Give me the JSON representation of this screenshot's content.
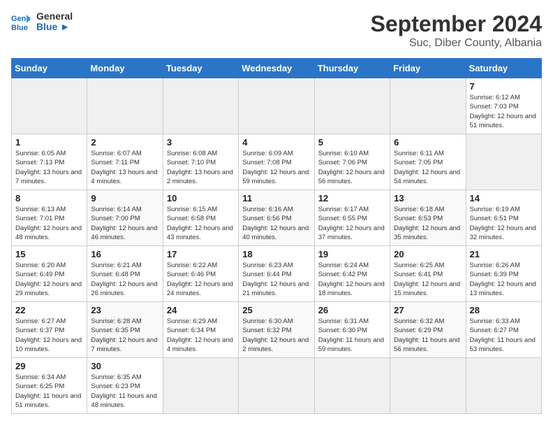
{
  "header": {
    "logo_line1": "General",
    "logo_line2": "Blue",
    "month": "September 2024",
    "location": "Suc, Diber County, Albania"
  },
  "weekdays": [
    "Sunday",
    "Monday",
    "Tuesday",
    "Wednesday",
    "Thursday",
    "Friday",
    "Saturday"
  ],
  "days": [
    {
      "num": "",
      "sunrise": "",
      "sunset": "",
      "daylight": ""
    },
    {
      "num": "",
      "sunrise": "",
      "sunset": "",
      "daylight": ""
    },
    {
      "num": "",
      "sunrise": "",
      "sunset": "",
      "daylight": ""
    },
    {
      "num": "",
      "sunrise": "",
      "sunset": "",
      "daylight": ""
    },
    {
      "num": "",
      "sunrise": "",
      "sunset": "",
      "daylight": ""
    },
    {
      "num": "",
      "sunrise": "",
      "sunset": "",
      "daylight": ""
    },
    {
      "num": "7",
      "sunrise": "Sunrise: 6:12 AM",
      "sunset": "Sunset: 7:03 PM",
      "daylight": "Daylight: 12 hours and 51 minutes."
    },
    {
      "num": "1",
      "sunrise": "Sunrise: 6:05 AM",
      "sunset": "Sunset: 7:13 PM",
      "daylight": "Daylight: 13 hours and 7 minutes."
    },
    {
      "num": "2",
      "sunrise": "Sunrise: 6:07 AM",
      "sunset": "Sunset: 7:11 PM",
      "daylight": "Daylight: 13 hours and 4 minutes."
    },
    {
      "num": "3",
      "sunrise": "Sunrise: 6:08 AM",
      "sunset": "Sunset: 7:10 PM",
      "daylight": "Daylight: 13 hours and 2 minutes."
    },
    {
      "num": "4",
      "sunrise": "Sunrise: 6:09 AM",
      "sunset": "Sunset: 7:08 PM",
      "daylight": "Daylight: 12 hours and 59 minutes."
    },
    {
      "num": "5",
      "sunrise": "Sunrise: 6:10 AM",
      "sunset": "Sunset: 7:06 PM",
      "daylight": "Daylight: 12 hours and 56 minutes."
    },
    {
      "num": "6",
      "sunrise": "Sunrise: 6:11 AM",
      "sunset": "Sunset: 7:05 PM",
      "daylight": "Daylight: 12 hours and 54 minutes."
    },
    {
      "num": "",
      "sunrise": "",
      "sunset": "",
      "daylight": ""
    },
    {
      "num": "8",
      "sunrise": "Sunrise: 6:13 AM",
      "sunset": "Sunset: 7:01 PM",
      "daylight": "Daylight: 12 hours and 48 minutes."
    },
    {
      "num": "9",
      "sunrise": "Sunrise: 6:14 AM",
      "sunset": "Sunset: 7:00 PM",
      "daylight": "Daylight: 12 hours and 46 minutes."
    },
    {
      "num": "10",
      "sunrise": "Sunrise: 6:15 AM",
      "sunset": "Sunset: 6:58 PM",
      "daylight": "Daylight: 12 hours and 43 minutes."
    },
    {
      "num": "11",
      "sunrise": "Sunrise: 6:16 AM",
      "sunset": "Sunset: 6:56 PM",
      "daylight": "Daylight: 12 hours and 40 minutes."
    },
    {
      "num": "12",
      "sunrise": "Sunrise: 6:17 AM",
      "sunset": "Sunset: 6:55 PM",
      "daylight": "Daylight: 12 hours and 37 minutes."
    },
    {
      "num": "13",
      "sunrise": "Sunrise: 6:18 AM",
      "sunset": "Sunset: 6:53 PM",
      "daylight": "Daylight: 12 hours and 35 minutes."
    },
    {
      "num": "14",
      "sunrise": "Sunrise: 6:19 AM",
      "sunset": "Sunset: 6:51 PM",
      "daylight": "Daylight: 12 hours and 32 minutes."
    },
    {
      "num": "15",
      "sunrise": "Sunrise: 6:20 AM",
      "sunset": "Sunset: 6:49 PM",
      "daylight": "Daylight: 12 hours and 29 minutes."
    },
    {
      "num": "16",
      "sunrise": "Sunrise: 6:21 AM",
      "sunset": "Sunset: 6:48 PM",
      "daylight": "Daylight: 12 hours and 26 minutes."
    },
    {
      "num": "17",
      "sunrise": "Sunrise: 6:22 AM",
      "sunset": "Sunset: 6:46 PM",
      "daylight": "Daylight: 12 hours and 24 minutes."
    },
    {
      "num": "18",
      "sunrise": "Sunrise: 6:23 AM",
      "sunset": "Sunset: 6:44 PM",
      "daylight": "Daylight: 12 hours and 21 minutes."
    },
    {
      "num": "19",
      "sunrise": "Sunrise: 6:24 AM",
      "sunset": "Sunset: 6:42 PM",
      "daylight": "Daylight: 12 hours and 18 minutes."
    },
    {
      "num": "20",
      "sunrise": "Sunrise: 6:25 AM",
      "sunset": "Sunset: 6:41 PM",
      "daylight": "Daylight: 12 hours and 15 minutes."
    },
    {
      "num": "21",
      "sunrise": "Sunrise: 6:26 AM",
      "sunset": "Sunset: 6:39 PM",
      "daylight": "Daylight: 12 hours and 13 minutes."
    },
    {
      "num": "22",
      "sunrise": "Sunrise: 6:27 AM",
      "sunset": "Sunset: 6:37 PM",
      "daylight": "Daylight: 12 hours and 10 minutes."
    },
    {
      "num": "23",
      "sunrise": "Sunrise: 6:28 AM",
      "sunset": "Sunset: 6:35 PM",
      "daylight": "Daylight: 12 hours and 7 minutes."
    },
    {
      "num": "24",
      "sunrise": "Sunrise: 6:29 AM",
      "sunset": "Sunset: 6:34 PM",
      "daylight": "Daylight: 12 hours and 4 minutes."
    },
    {
      "num": "25",
      "sunrise": "Sunrise: 6:30 AM",
      "sunset": "Sunset: 6:32 PM",
      "daylight": "Daylight: 12 hours and 2 minutes."
    },
    {
      "num": "26",
      "sunrise": "Sunrise: 6:31 AM",
      "sunset": "Sunset: 6:30 PM",
      "daylight": "Daylight: 11 hours and 59 minutes."
    },
    {
      "num": "27",
      "sunrise": "Sunrise: 6:32 AM",
      "sunset": "Sunset: 6:29 PM",
      "daylight": "Daylight: 11 hours and 56 minutes."
    },
    {
      "num": "28",
      "sunrise": "Sunrise: 6:33 AM",
      "sunset": "Sunset: 6:27 PM",
      "daylight": "Daylight: 11 hours and 53 minutes."
    },
    {
      "num": "29",
      "sunrise": "Sunrise: 6:34 AM",
      "sunset": "Sunset: 6:25 PM",
      "daylight": "Daylight: 11 hours and 51 minutes."
    },
    {
      "num": "30",
      "sunrise": "Sunrise: 6:35 AM",
      "sunset": "Sunset: 6:23 PM",
      "daylight": "Daylight: 11 hours and 48 minutes."
    },
    {
      "num": "",
      "sunrise": "",
      "sunset": "",
      "daylight": ""
    },
    {
      "num": "",
      "sunrise": "",
      "sunset": "",
      "daylight": ""
    },
    {
      "num": "",
      "sunrise": "",
      "sunset": "",
      "daylight": ""
    },
    {
      "num": "",
      "sunrise": "",
      "sunset": "",
      "daylight": ""
    },
    {
      "num": "",
      "sunrise": "",
      "sunset": "",
      "daylight": ""
    }
  ]
}
